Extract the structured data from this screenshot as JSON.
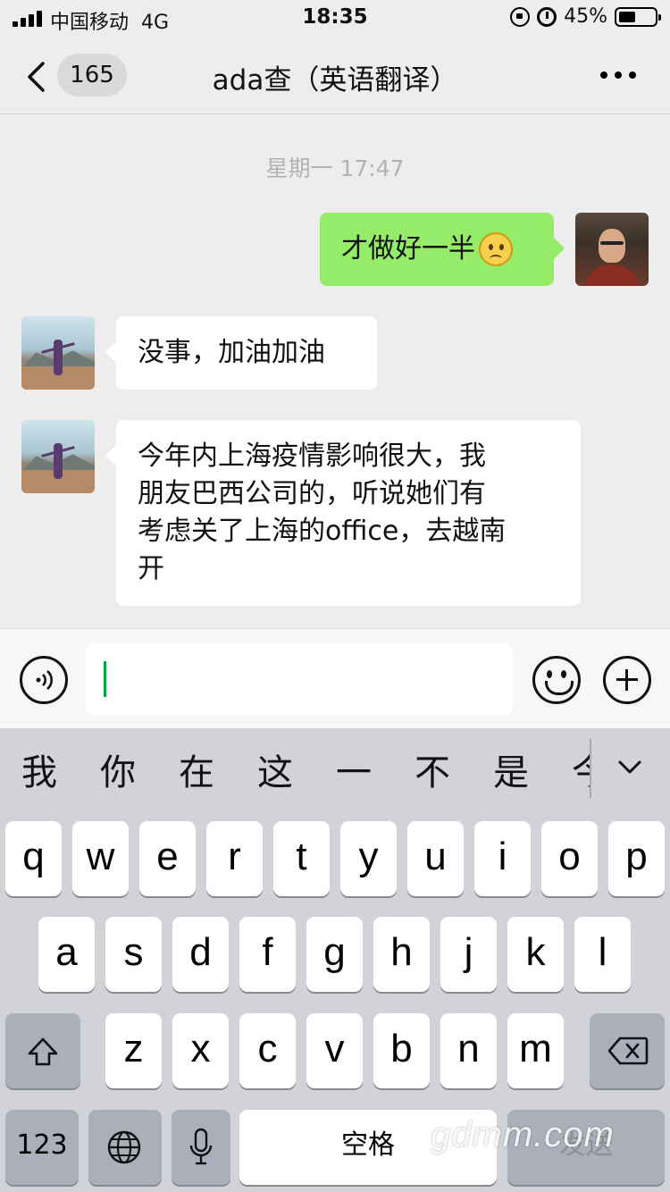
{
  "status_bar": {
    "carrier": "中国移动",
    "network": "4G",
    "time": "18:35",
    "battery": "45%"
  },
  "nav": {
    "unread_count": "165",
    "title": "ada查（英语翻译）"
  },
  "messages": {
    "timestamp": "星期一 17:47",
    "items": [
      {
        "sender": "self",
        "text": "才做好一半",
        "emoji": "sad-face"
      },
      {
        "sender": "other",
        "text": "没事，加油加油"
      },
      {
        "sender": "other",
        "lines": [
          "今年内上海疫情影响很大，我",
          "朋友巴西公司的，听说她们有",
          "考虑关了上海的office，去越南",
          "开"
        ]
      }
    ]
  },
  "input": {
    "value": ""
  },
  "keyboard": {
    "candidates": [
      "我",
      "你",
      "在",
      "这",
      "一",
      "不",
      "是",
      "今"
    ],
    "row1": [
      "q",
      "w",
      "e",
      "r",
      "t",
      "y",
      "u",
      "i",
      "o",
      "p"
    ],
    "row2": [
      "a",
      "s",
      "d",
      "f",
      "g",
      "h",
      "j",
      "k",
      "l"
    ],
    "row3": [
      "z",
      "x",
      "c",
      "v",
      "b",
      "n",
      "m"
    ],
    "numbers_label": "123",
    "space_label": "空格",
    "send_label": "发送"
  },
  "watermark": "gdmm.com",
  "colors": {
    "self_bubble": "#95ec69",
    "other_bubble": "#ffffff",
    "background": "#ededed",
    "keyboard_bg": "#d1d3d9",
    "caret": "#07a14a"
  }
}
